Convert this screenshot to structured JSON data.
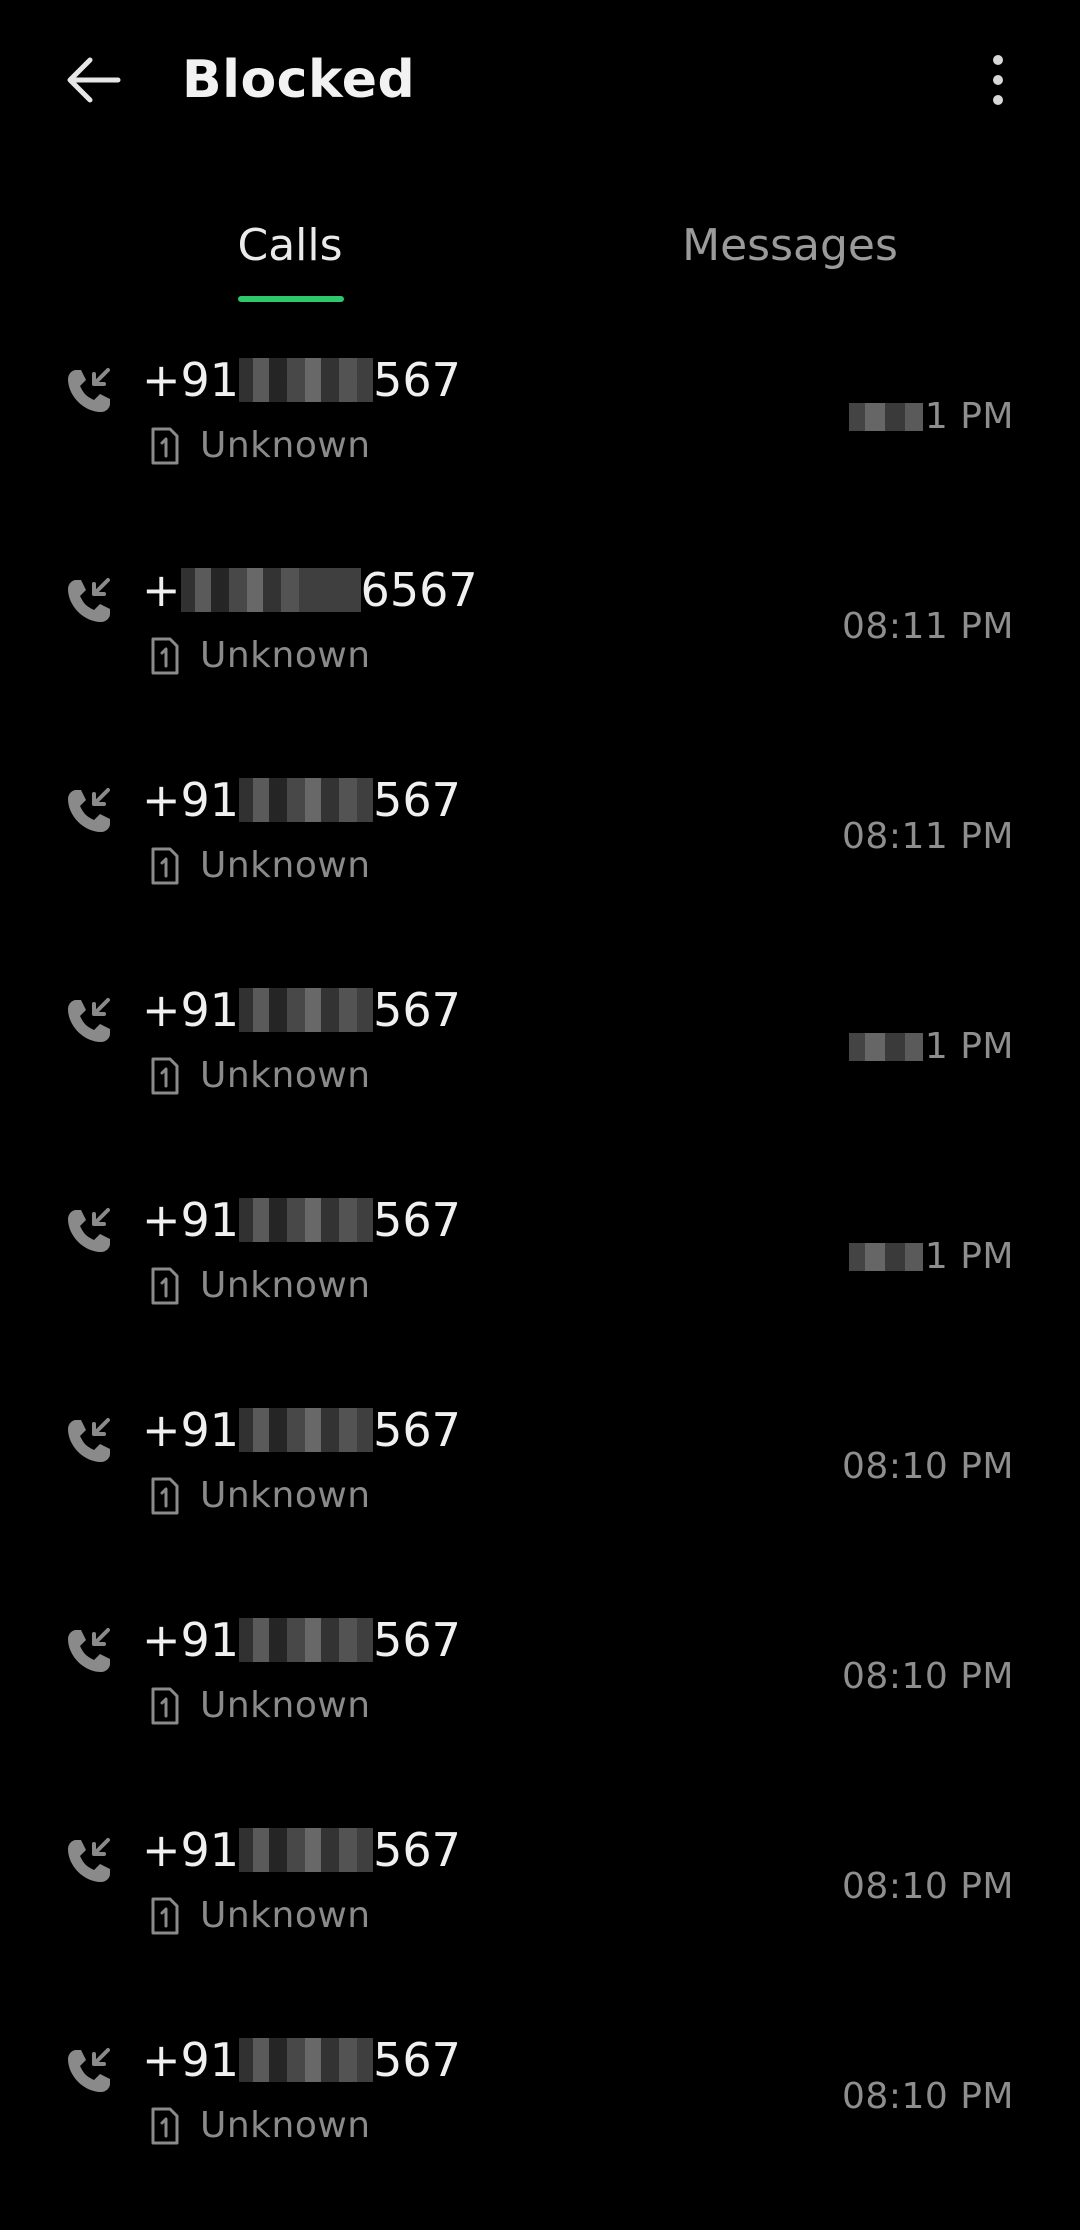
{
  "header": {
    "title": "Blocked",
    "back_icon": "back-arrow-icon",
    "more_icon": "more-vertical-icon"
  },
  "tabs": [
    {
      "label": "Calls",
      "selected": true
    },
    {
      "label": "Messages",
      "selected": false
    }
  ],
  "colors": {
    "background": "#000000",
    "accent": "#2fc76b",
    "primary_text": "#f0f0f0",
    "secondary_text": "#8a8a8a"
  },
  "calls": [
    {
      "number_prefix": "+91",
      "number_suffix": "567",
      "sim": "Unknown",
      "time_prefix": "",
      "time": "1 PM",
      "icon": "blocked-call-icon",
      "sim_icon": "sim-1-icon"
    },
    {
      "number_prefix": "+",
      "number_suffix": "6567",
      "sim": "Unknown",
      "time_prefix": "",
      "time": "08:11 PM",
      "icon": "blocked-call-icon",
      "sim_icon": "sim-1-icon"
    },
    {
      "number_prefix": "+91",
      "number_suffix": "567",
      "sim": "Unknown",
      "time_prefix": "",
      "time": "08:11 PM",
      "icon": "blocked-call-icon",
      "sim_icon": "sim-1-icon"
    },
    {
      "number_prefix": "+91",
      "number_suffix": "567",
      "sim": "Unknown",
      "time_prefix": "",
      "time": "1 PM",
      "icon": "blocked-call-icon",
      "sim_icon": "sim-1-icon"
    },
    {
      "number_prefix": "+91",
      "number_suffix": "567",
      "sim": "Unknown",
      "time_prefix": "",
      "time": "1 PM",
      "icon": "blocked-call-icon",
      "sim_icon": "sim-1-icon"
    },
    {
      "number_prefix": "+91",
      "number_suffix": "567",
      "sim": "Unknown",
      "time_prefix": "",
      "time": "08:10 PM",
      "icon": "blocked-call-icon",
      "sim_icon": "sim-1-icon"
    },
    {
      "number_prefix": "+91",
      "number_suffix": "567",
      "sim": "Unknown",
      "time_prefix": "",
      "time": "08:10 PM",
      "icon": "blocked-call-icon",
      "sim_icon": "sim-1-icon"
    },
    {
      "number_prefix": "+91",
      "number_suffix": "567",
      "sim": "Unknown",
      "time_prefix": "",
      "time": "08:10 PM",
      "icon": "blocked-call-icon",
      "sim_icon": "sim-1-icon"
    },
    {
      "number_prefix": "+91",
      "number_suffix": "567",
      "sim": "Unknown",
      "time_prefix": "",
      "time": "08:10 PM",
      "icon": "blocked-call-icon",
      "sim_icon": "sim-1-icon"
    }
  ]
}
